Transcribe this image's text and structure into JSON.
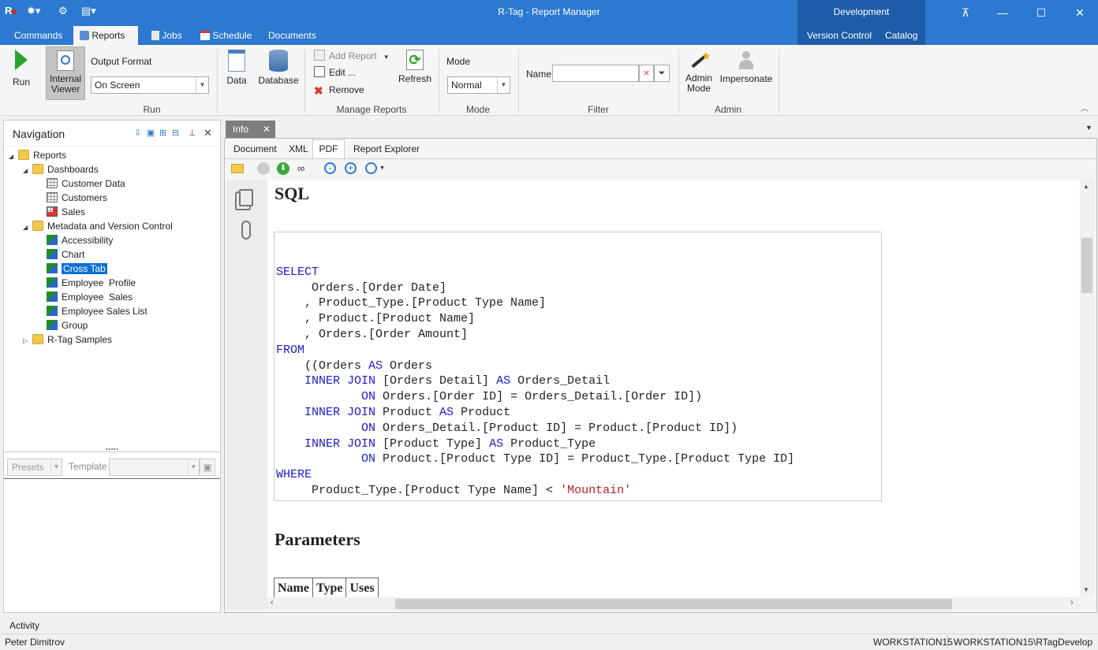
{
  "app": {
    "title": "R-Tag - Report Manager",
    "tabs": [
      {
        "label": "Commands"
      },
      {
        "label": "Reports"
      },
      {
        "label": "Jobs"
      },
      {
        "label": "Schedule"
      },
      {
        "label": "Documents"
      }
    ],
    "context_group": {
      "label": "Development",
      "tabs": [
        "Version Control",
        "Catalog"
      ]
    }
  },
  "ribbon": {
    "run": {
      "run_label": "Run",
      "viewer_label_1": "Internal",
      "viewer_label_2": "Viewer",
      "output_format_label": "Output Format",
      "output_format_value": "On Screen",
      "group_label": "Run"
    },
    "data": {
      "data_label": "Data",
      "database_label": "Database"
    },
    "manage": {
      "add_label": "Add Report",
      "edit_label": "Edit ...",
      "remove_label": "Remove",
      "refresh_label": "Refresh",
      "group_label": "Manage Reports"
    },
    "mode": {
      "label": "Mode",
      "value": "Normal",
      "group_label": "Mode"
    },
    "filter": {
      "name_label": "Name",
      "name_value": "",
      "group_label": "Filter"
    },
    "admin": {
      "admin_label_1": "Admin",
      "admin_label_2": "Mode",
      "impersonate_label": "Impersonate",
      "group_label": "Admin"
    }
  },
  "navigation": {
    "title": "Navigation",
    "tree": {
      "reports": "Reports",
      "dashboards": "Dashboards",
      "dashboard_items": [
        "Customer Data",
        "Customers",
        "Sales"
      ],
      "metadata": "Metadata and Version Control",
      "metadata_items": [
        "Accessibility",
        "Chart",
        "Cross Tab",
        "Employee  Profile",
        "Employee  Sales",
        "Employee Sales List",
        "Group"
      ],
      "samples": "R-Tag Samples"
    },
    "grip": ".....",
    "presets_label": "Presets",
    "template_label": "Template",
    "activity_label": "Activity"
  },
  "content": {
    "doc_tab": "Info",
    "subtabs": [
      "Document",
      "XML",
      "PDF",
      "Report Explorer"
    ],
    "active_subtab": "PDF",
    "sql_heading": "SQL",
    "sql": {
      "l1": "SELECT",
      "l2": "     Orders.[Order Date]",
      "l3": "    , Product_Type.[Product Type Name]",
      "l4": "    , Product.[Product Name]",
      "l5": "    , Orders.[Order Amount]",
      "l6": "FROM",
      "l7": "    ((Orders ",
      "l7kw": "AS",
      "l7b": " Orders",
      "ij": "INNER JOIN",
      "on": "ON",
      "as": "AS",
      "l8b": " [Orders Detail] ",
      "l8c": " Orders_Detail",
      "l9b": " Orders.[Order ID] = Orders_Detail.[Order ID])",
      "l10b": " Product ",
      "l10c": " Product",
      "l11b": " Orders_Detail.[Product ID] = Product.[Product ID])",
      "l12b": " [Product Type] ",
      "l12c": " Product_Type",
      "l13b": " Product.[Product Type ID] = Product_Type.[Product Type ID]",
      "l14": "WHERE",
      "l15": "     Product_Type.[Product Type Name] < ",
      "l15s": "'Mountain'"
    },
    "params_heading": "Parameters",
    "params_cols": [
      "Name",
      "Type",
      "Uses"
    ]
  },
  "status": {
    "user": "Peter Dimitrov",
    "machine": "WORKSTATION15",
    "database": "WORKSTATION15\\RTagDevelop"
  },
  "colors": {
    "titlebar": "#2b79d0",
    "context_group": "#1c5ca8",
    "selection": "#0b6fd6",
    "keyword": "#1b1bd0",
    "string": "#b22222"
  }
}
